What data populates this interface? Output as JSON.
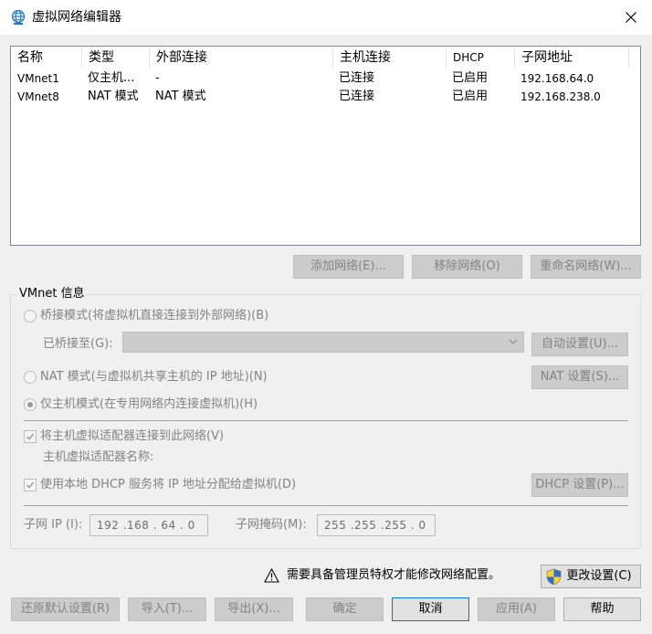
{
  "window": {
    "title": "虚拟网络编辑器",
    "icon": "globe-icon",
    "close_icon": "close-icon"
  },
  "network_list": {
    "columns": [
      "名称",
      "类型",
      "外部连接",
      "主机连接",
      "DHCP",
      "子网地址"
    ],
    "rows": [
      [
        "VMnet1",
        "仅主机...",
        "-",
        "已连接",
        "已启用",
        "192.168.64.0"
      ],
      [
        "VMnet8",
        "NAT 模式",
        "NAT 模式",
        "已连接",
        "已启用",
        "192.168.238.0"
      ]
    ]
  },
  "list_buttons": {
    "add": "添加网络(E)...",
    "remove": "移除网络(O)",
    "rename": "重命名网络(W)..."
  },
  "vmnet_info": {
    "group_label": "VMnet 信息",
    "bridged_label": "桥接模式(将虚拟机直接连接到外部网络)(B)",
    "bridged_to_label": "已桥接至(G):",
    "bridged_to_value": "",
    "auto_settings": "自动设置(U)...",
    "nat_label": "NAT 模式(与虚拟机共享主机的 IP 地址)(N)",
    "nat_settings": "NAT 设置(S)...",
    "hostonly_label": "仅主机模式(在专用网络内连接虚拟机)(H)",
    "selected_mode": "hostonly",
    "connect_adapter_label": "将主机虚拟适配器连接到此网络(V)",
    "connect_adapter_checked": true,
    "adapter_name_label": "主机虚拟适配器名称:",
    "dhcp_label": "使用本地 DHCP 服务将 IP 地址分配给虚拟机(D)",
    "dhcp_checked": true,
    "dhcp_settings": "DHCP 设置(P)...",
    "subnet_ip_label": "子网 IP (I):",
    "subnet_ip_value": "192 .168 . 64  .  0",
    "subnet_mask_label": "子网掩码(M):",
    "subnet_mask_value": "255 .255 .255 .  0"
  },
  "admin_notice": {
    "text": "需要具备管理员特权才能修改网络配置。",
    "warning_icon": "warning-icon",
    "change_settings": "更改设置(C)",
    "shield_icon": "uac-shield-icon"
  },
  "footer_buttons": {
    "restore": "还原默认设置(R)",
    "import": "导入(T)...",
    "export": "导出(X)...",
    "ok": "确定",
    "cancel": "取消",
    "apply": "应用(A)",
    "help": "帮助"
  },
  "colors": {
    "accent": "#0078d7",
    "disabled_text": "#838383",
    "disabled_button": "#cccccc",
    "dialog_bg": "#f0f0f0"
  }
}
